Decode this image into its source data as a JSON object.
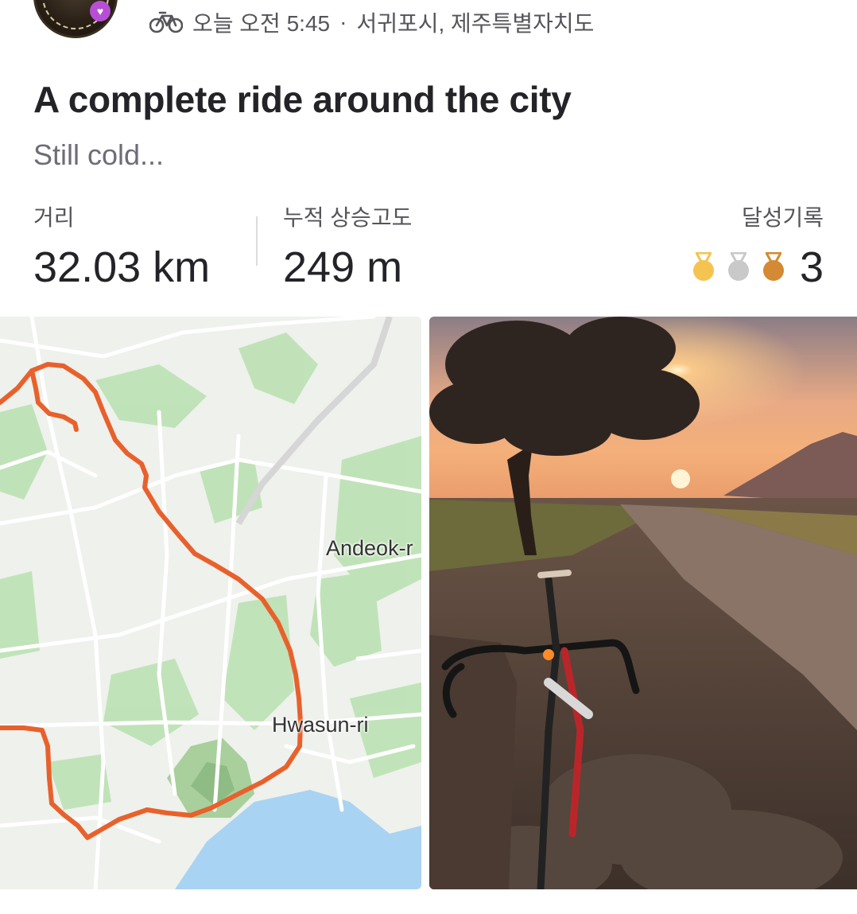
{
  "activity": {
    "sport_icon": "bike-icon",
    "datetime": "오늘 오전 5:45",
    "separator": "·",
    "location": "서귀포시, 제주특별자치도",
    "title": "A complete ride around the city",
    "description": "Still cold..."
  },
  "stats": {
    "distance": {
      "label": "거리",
      "value": "32.03 km"
    },
    "elevation": {
      "label": "누적 상승고도",
      "value": "249 m"
    },
    "achievements": {
      "label": "달성기록",
      "count": "3",
      "medals": [
        "gold-medal-icon",
        "silver-medal-icon",
        "bronze-medal-icon"
      ]
    }
  },
  "map": {
    "places": {
      "andeok": "Andeok-r",
      "hwasun": "Hwasun-ri"
    },
    "route_color": "#e8612c"
  },
  "colors": {
    "gold": "#f5c350",
    "silver": "#c9c9c9",
    "bronze": "#d38a32"
  }
}
